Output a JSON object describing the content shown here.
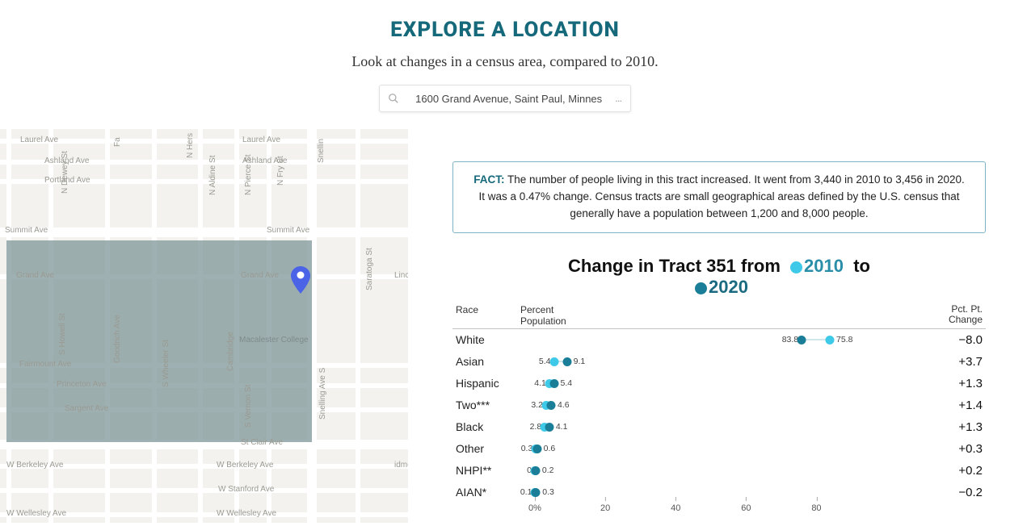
{
  "header": {
    "title": "EXPLORE A LOCATION",
    "subtitle": "Look at changes in a census area, compared to 2010."
  },
  "search": {
    "value": "1600 Grand Avenue, Saint Paul, Minnes",
    "ellipsis": "…"
  },
  "map": {
    "streets_h": [
      "Laurel Ave",
      "Ashland Ave",
      "Portland Ave",
      "Summit Ave",
      "Grand Ave",
      "Fairmount Ave",
      "Princeton Ave",
      "Sargent Ave",
      "St Clair Ave",
      "W Berkeley Ave",
      "W Stanford Ave",
      "W Wellesley Ave"
    ],
    "streets_v": [
      "N Dewey St",
      "Fa",
      "N Hers",
      "N Aldine St",
      "N Pierce St",
      "N Fry St",
      "Snellin",
      "Saratoga St",
      "S Howell St",
      "Goodrich Ave",
      "S Wheeler St",
      "Cambridge",
      "S Vernon St",
      "Snelling Ave S"
    ],
    "poi": "Macalester College",
    "extra": [
      "Linco",
      "idmers"
    ]
  },
  "fact": {
    "label": "FACT:",
    "text": "The number of people living in this tract increased. It went from 3,440 in 2010 to 3,456 in 2020. It was a 0.47% change. Census tracts are small geographical areas defined by the U.S. census that generally have a population between 1,200 and 8,000 people."
  },
  "chart_title": {
    "prefix": "Change in Tract 351 from",
    "y2010": "2010",
    "mid": "to",
    "y2020": "2020"
  },
  "table_headers": {
    "race": "Race",
    "pct": "Percent\nPopulation",
    "change": "Pct. Pt.\nChange"
  },
  "axis": {
    "ticks": [
      "0%",
      "20",
      "40",
      "60",
      "80"
    ],
    "min": 0,
    "max": 90
  },
  "chart_data": {
    "type": "dot-plot",
    "title": "Change in Tract 351 from 2010 to 2020",
    "xlabel": "Percent Population",
    "ylabel": "Race",
    "xlim": [
      0,
      90
    ],
    "categories": [
      "White",
      "Asian",
      "Hispanic",
      "Two***",
      "Black",
      "Other",
      "NHPI**",
      "AIAN*"
    ],
    "series": [
      {
        "name": "2010",
        "color": "#3ec9e8",
        "values": [
          83.8,
          5.4,
          4.1,
          3.2,
          2.8,
          0.3,
          0,
          0.1
        ]
      },
      {
        "name": "2020",
        "color": "#1a7e98",
        "values": [
          75.8,
          9.1,
          5.4,
          4.6,
          4.1,
          0.6,
          0.2,
          0.3
        ]
      }
    ],
    "change": [
      -8.0,
      3.7,
      1.3,
      1.4,
      1.3,
      0.3,
      0.2,
      -0.2
    ],
    "change_display": [
      "−8.0",
      "+3.7",
      "+1.3",
      "+1.4",
      "+1.3",
      "+0.3",
      "+0.2",
      "−0.2"
    ]
  }
}
